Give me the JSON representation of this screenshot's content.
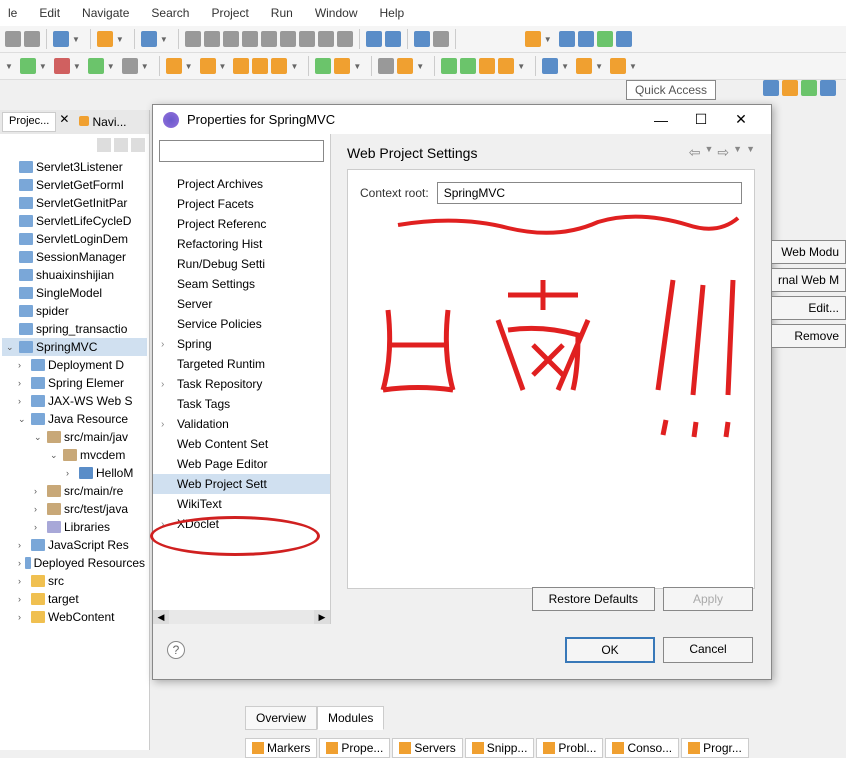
{
  "menubar": [
    "le",
    "Edit",
    "Navigate",
    "Search",
    "Project",
    "Run",
    "Window",
    "Help"
  ],
  "quick_access": "Quick Access",
  "project_explorer": {
    "tab1": "Projec...",
    "tab2": "Navi...",
    "items": [
      {
        "label": "Servlet3Listener",
        "icon": "folder"
      },
      {
        "label": "ServletGetFormI",
        "icon": "folder"
      },
      {
        "label": "ServletGetInitPar",
        "icon": "folder"
      },
      {
        "label": "ServletLifeCycleD",
        "icon": "folder"
      },
      {
        "label": "ServletLoginDem",
        "icon": "folder"
      },
      {
        "label": "SessionManager",
        "icon": "folder"
      },
      {
        "label": "shuaixinshijian",
        "icon": "folder"
      },
      {
        "label": "SingleModel",
        "icon": "folder"
      },
      {
        "label": "spider",
        "icon": "folder"
      },
      {
        "label": "spring_transactio",
        "icon": "folder"
      },
      {
        "label": "SpringMVC",
        "icon": "folder",
        "selected": true,
        "expand": true
      },
      {
        "label": "Deployment D",
        "icon": "folder",
        "level": 1,
        "exp": ">"
      },
      {
        "label": "Spring Elemer",
        "icon": "folder",
        "level": 1,
        "exp": ">"
      },
      {
        "label": "JAX-WS Web S",
        "icon": "folder",
        "level": 1,
        "exp": ">"
      },
      {
        "label": "Java Resource",
        "icon": "folder",
        "level": 1,
        "exp": "v"
      },
      {
        "label": "src/main/jav",
        "icon": "pkg",
        "level": 2,
        "exp": "v"
      },
      {
        "label": "mvcdem",
        "icon": "pkg",
        "level": 3,
        "exp": "v"
      },
      {
        "label": "HelloM",
        "icon": "java",
        "level": 4,
        "exp": ">"
      },
      {
        "label": "src/main/re",
        "icon": "pkg",
        "level": 2,
        "exp": ">"
      },
      {
        "label": "src/test/java",
        "icon": "pkg",
        "level": 2,
        "exp": ">"
      },
      {
        "label": "Libraries",
        "icon": "lib",
        "level": 2,
        "exp": ">"
      },
      {
        "label": "JavaScript Res",
        "icon": "folder",
        "level": 1,
        "exp": ">"
      },
      {
        "label": "Deployed Resources",
        "icon": "folder",
        "level": 1,
        "exp": ">"
      },
      {
        "label": "src",
        "icon": "yellow",
        "level": 1,
        "exp": ">"
      },
      {
        "label": "target",
        "icon": "yellow",
        "level": 1,
        "exp": ">"
      },
      {
        "label": "WebContent",
        "icon": "yellow",
        "level": 1,
        "exp": ">"
      }
    ]
  },
  "dialog": {
    "title": "Properties for SpringMVC",
    "section_title": "Web Project Settings",
    "categories": [
      {
        "label": "Project Archives",
        "exp": ""
      },
      {
        "label": "Project Facets",
        "exp": ""
      },
      {
        "label": "Project Referenc",
        "exp": ""
      },
      {
        "label": "Refactoring Hist",
        "exp": ""
      },
      {
        "label": "Run/Debug Setti",
        "exp": ""
      },
      {
        "label": "Seam Settings",
        "exp": ""
      },
      {
        "label": "Server",
        "exp": ""
      },
      {
        "label": "Service Policies",
        "exp": ""
      },
      {
        "label": "Spring",
        "exp": ">"
      },
      {
        "label": "Targeted Runtim",
        "exp": ""
      },
      {
        "label": "Task Repository",
        "exp": ">"
      },
      {
        "label": "Task Tags",
        "exp": ""
      },
      {
        "label": "Validation",
        "exp": ">"
      },
      {
        "label": "Web Content Set",
        "exp": ""
      },
      {
        "label": "Web Page Editor",
        "exp": ""
      },
      {
        "label": "Web Project Sett",
        "exp": "",
        "selected": true
      },
      {
        "label": "WikiText",
        "exp": ""
      },
      {
        "label": "XDoclet",
        "exp": ">"
      }
    ],
    "context_root_label": "Context root:",
    "context_root_value": "SpringMVC",
    "buttons": {
      "restore": "Restore Defaults",
      "apply": "Apply",
      "ok": "OK",
      "cancel": "Cancel"
    }
  },
  "right_panel": {
    "web_module": "Web Modu",
    "rnal_web": "rnal Web M",
    "edit": "Edit...",
    "remove": "Remove"
  },
  "bottom_tabs": {
    "overview": "Overview",
    "modules": "Modules"
  },
  "bottom_views": [
    "Markers",
    "Prope...",
    "Servers",
    "Snipp...",
    "Probl...",
    "Conso...",
    "Progr..."
  ]
}
